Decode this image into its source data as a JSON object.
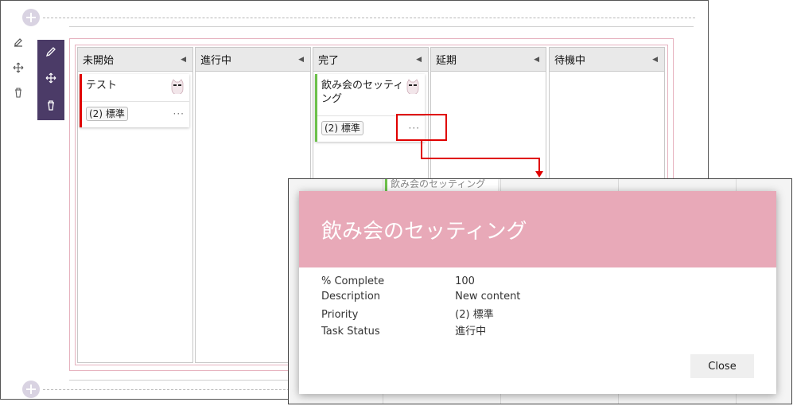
{
  "board": {
    "columns": [
      {
        "title": "未開始"
      },
      {
        "title": "進行中"
      },
      {
        "title": "完了"
      },
      {
        "title": "延期"
      },
      {
        "title": "待機中"
      }
    ],
    "cards": [
      {
        "title": "テスト",
        "priority": "(2) 標準",
        "status_color": "#e00000"
      },
      {
        "title": "飲み会のセッティング",
        "priority": "(2) 標準",
        "status_color": "#6cc04a"
      }
    ],
    "ghost_card_title": "飲み会のセッティング"
  },
  "dialog": {
    "title": "飲み会のセッティング",
    "fields": [
      {
        "label": "% Complete",
        "value": "100"
      },
      {
        "label": "Description",
        "value": "New content"
      },
      {
        "label": "Priority",
        "value": "(2) 標準"
      },
      {
        "label": "Task Status",
        "value": "進行中"
      }
    ],
    "close_label": "Close"
  },
  "colors": {
    "accent_header": "#e8a9b8",
    "toolbar": "#4b3b67",
    "highlight": "#e00000"
  }
}
